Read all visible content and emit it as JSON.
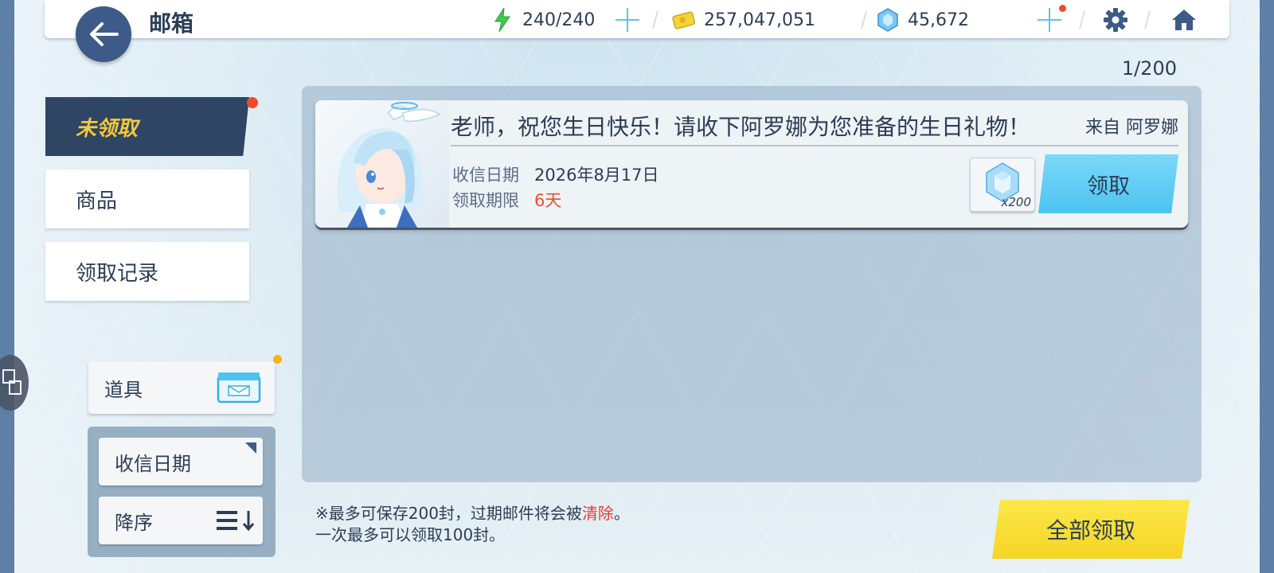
{
  "header": {
    "title": "邮箱",
    "stamina": "240/240",
    "credits": "257,047,051",
    "gems": "45,672"
  },
  "mail_count": "1/200",
  "tabs": [
    {
      "label": "未领取",
      "active": true
    },
    {
      "label": "商品",
      "active": false
    },
    {
      "label": "领取记录",
      "active": false
    }
  ],
  "filter": {
    "label": "道具"
  },
  "sort": {
    "field": "收信日期",
    "order": "降序"
  },
  "mails": [
    {
      "subject": "老师，祝您生日快乐！请收下阿罗娜为您准备的生日礼物！",
      "from": "来自 阿罗娜",
      "date_label": "收信日期",
      "date_value": "2026年8月17日",
      "limit_label": "领取期限",
      "limit_value": "6天",
      "reward_count": "x200",
      "claim_label": "领取"
    }
  ],
  "notice": {
    "line1_prefix": "※最多可保存200封，过期邮件将会被",
    "line1_highlight": "清除",
    "line1_suffix": "。",
    "line2": "一次最多可以领取100封。"
  },
  "claim_all_label": "全部领取",
  "colors": {
    "accent_navy": "#2e4564",
    "active_tab_text": "#f2c83b",
    "claim_button": "#4cc3f1",
    "claim_all_button": "#f5d523",
    "warning": "#e8502a"
  }
}
